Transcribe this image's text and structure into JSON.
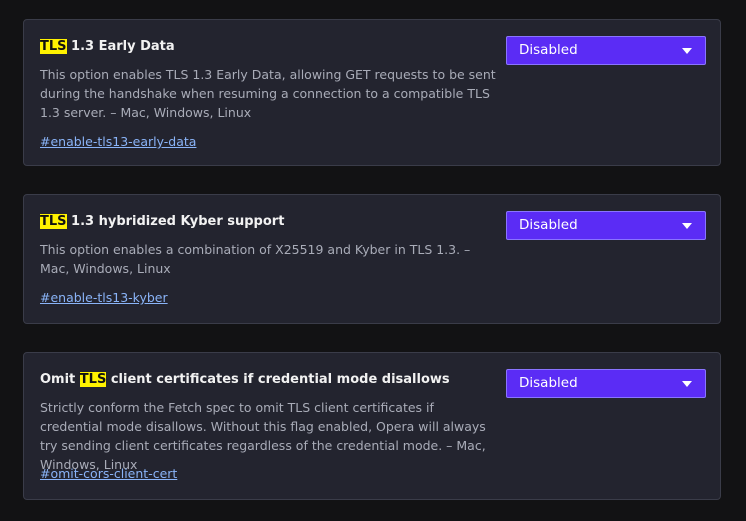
{
  "flags": [
    {
      "title_pre": "",
      "title_hl": "TLS",
      "title_post": " 1.3 Early Data",
      "description": "This option enables TLS 1.3 Early Data, allowing GET requests to be sent during the handshake when resuming a connection to a compatible TLS 1.3 server. – Mac, Windows, Linux",
      "link": "#enable-tls13-early-data",
      "selected": "Disabled"
    },
    {
      "title_pre": "",
      "title_hl": "TLS",
      "title_post": " 1.3 hybridized Kyber support",
      "description": "This option enables a combination of X25519 and Kyber in TLS 1.3. – Mac, Windows, Linux",
      "link": "#enable-tls13-kyber",
      "selected": "Disabled"
    },
    {
      "title_pre": "Omit ",
      "title_hl": "TLS",
      "title_post": " client certificates if credential mode disallows",
      "description": "Strictly conform the Fetch spec to omit TLS client certificates if credential mode disallows. Without this flag enabled, Opera will always try sending client certificates regardless of the credential mode. – Mac, Windows, Linux",
      "link": "#omit-cors-client-cert",
      "selected": "Disabled"
    }
  ],
  "icons": {
    "dropdown": "chevron-down-icon"
  },
  "colors": {
    "highlight": "#fff200",
    "select_bg": "#5b2cf5",
    "link": "#8ab4f8",
    "card_bg": "#23242f"
  }
}
